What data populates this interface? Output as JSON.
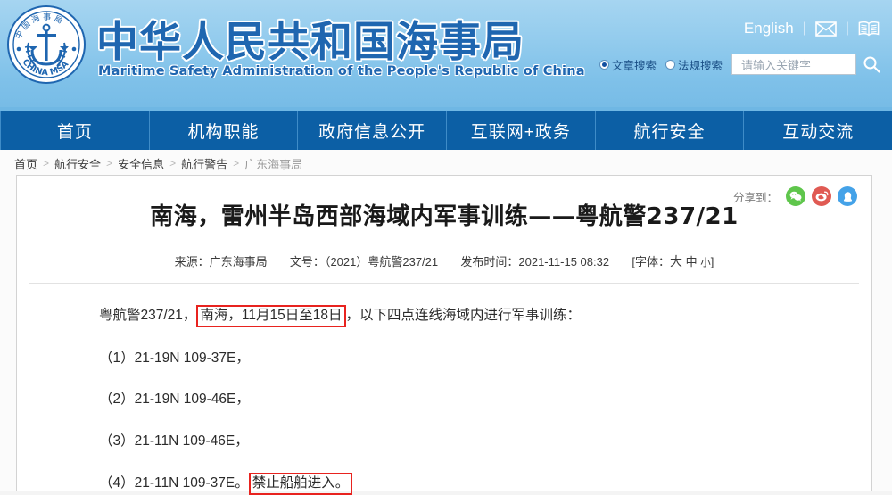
{
  "header": {
    "emblem_alt": "china-msa-emblem",
    "emblem_text_cn": "中国海事局",
    "emblem_text_en": "CHINA MSA",
    "brand_cn": "中华人民共和国海事局",
    "brand_en": "Maritime Safety Administration of the People's Republic of China",
    "english_link": "English",
    "separator": "|",
    "mail_icon": "mail-icon",
    "book_icon": "book-icon",
    "search": {
      "options": [
        {
          "label": "文章搜索",
          "selected": true
        },
        {
          "label": "法规搜索",
          "selected": false
        }
      ],
      "placeholder": "请输入关键字",
      "value": "",
      "button_icon": "search-icon"
    }
  },
  "nav": {
    "items": [
      {
        "label": "首页"
      },
      {
        "label": "机构职能"
      },
      {
        "label": "政府信息公开"
      },
      {
        "label": "互联网+政务"
      },
      {
        "label": "航行安全"
      },
      {
        "label": "互动交流"
      }
    ]
  },
  "breadcrumb": {
    "separator": ">",
    "items": [
      {
        "label": "首页"
      },
      {
        "label": "航行安全"
      },
      {
        "label": "安全信息"
      },
      {
        "label": "航行警告"
      },
      {
        "label": "广东海事局"
      }
    ]
  },
  "article": {
    "share_label": "分享到：",
    "share_icons": [
      {
        "name": "wechat-share-icon",
        "color": "#5fc64c"
      },
      {
        "name": "weibo-share-icon",
        "color": "#e05a53"
      },
      {
        "name": "qzone-share-icon",
        "color": "#44a2e8"
      }
    ],
    "title": "南海，雷州半岛西部海域内军事训练——粤航警237/21",
    "meta": {
      "source_label": "来源：",
      "source_value": "广东海事局",
      "docno_label": "文号：",
      "docno_value": "（2021）粤航警237/21",
      "published_label": "发布时间：",
      "published_value": "2021-11-15 08:32",
      "font_prefix": "[字体：",
      "font_big": "大",
      "font_mid": "中",
      "font_small": "小",
      "font_suffix": "]"
    },
    "paragraphs": {
      "p1_before": "粤航警237/21，",
      "p1_highlight": "南海，11月15日至18日",
      "p1_after": "，以下四点连线海域内进行军事训练：",
      "p2": "（1）21-19N 109-37E，",
      "p3": "（2）21-19N 109-46E，",
      "p4": "（3）21-11N 109-46E，",
      "p5_before": "（4）21-11N 109-37E。",
      "p5_highlight": "禁止船舶进入。"
    },
    "highlight_color": "#e8231f"
  }
}
